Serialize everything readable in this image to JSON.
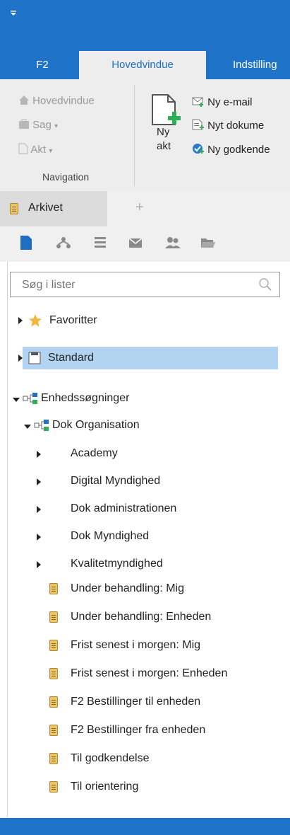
{
  "qat": {
    "icon": "dropdown-triangle"
  },
  "tabs": [
    {
      "label": "F2"
    },
    {
      "label": "Hovedvindue"
    },
    {
      "label": "Indstilling"
    }
  ],
  "ribbon": {
    "nav_items": [
      {
        "label": "Hovedvindue",
        "icon": "home-icon"
      },
      {
        "label": "Sag",
        "icon": "case-icon"
      },
      {
        "label": "Akt",
        "icon": "document-icon"
      }
    ],
    "group_label": "Navigation",
    "ny_akt_label_1": "Ny",
    "ny_akt_label_2": "akt",
    "new_items": [
      {
        "label": "Ny e-mail",
        "icon": "email-icon"
      },
      {
        "label": "Nyt dokume",
        "icon": "new-document-icon"
      },
      {
        "label": "Ny godkende",
        "icon": "approval-icon"
      }
    ]
  },
  "doctabs": {
    "active": "Arkivet",
    "add": "+"
  },
  "search": {
    "placeholder": "Søg i lister"
  },
  "tree": {
    "favoritter": "Favoritter",
    "standard": "Standard",
    "enhedssoegninger": "Enhedssøgninger",
    "dok_org": "Dok Organisation",
    "units": [
      "Academy",
      "Digital Myndighed",
      "Dok administrationen",
      "Dok Myndighed",
      "Kvalitetmyndighed"
    ],
    "lists": [
      "Under behandling: Mig",
      "Under behandling: Enheden",
      "Frist senest i morgen: Mig",
      "Frist senest i morgen: Enheden",
      "F2 Bestillinger til enheden",
      "F2 Bestillinger fra enheden",
      "Til godkendelse",
      "Til orientering"
    ]
  },
  "colors": {
    "accent": "#1e73c8",
    "selected": "#b3d4f0"
  }
}
